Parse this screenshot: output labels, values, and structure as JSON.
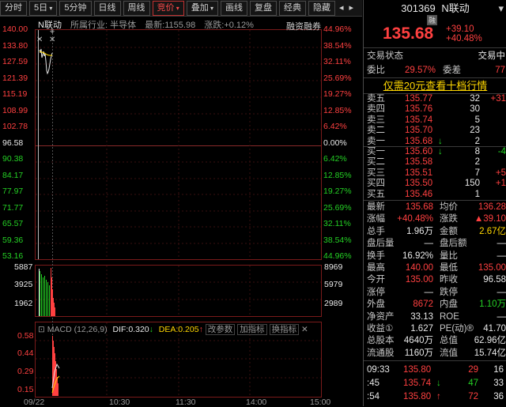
{
  "toolbar": {
    "tabs": [
      "分时",
      "5日",
      "5分钟",
      "日线",
      "周线",
      "竞价",
      "叠加",
      "画线",
      "复盘",
      "经典",
      "隐藏"
    ],
    "nav_left": "◂",
    "nav_right": "▸"
  },
  "chart": {
    "stock_name": "N联动",
    "industry": "所属行业: 半导体",
    "latest": "最新:1155.98",
    "change": "涨跌:+0.12%",
    "rzrq": "融资融券",
    "price_labels": [
      "140.00",
      "133.80",
      "127.59",
      "121.39",
      "115.19",
      "108.99",
      "102.78",
      "96.58",
      "90.38",
      "84.17",
      "77.97",
      "71.77",
      "65.57",
      "59.36",
      "53.16"
    ],
    "pct_labels": [
      "44.96%",
      "38.54%",
      "32.11%",
      "25.69%",
      "19.27%",
      "12.85%",
      "6.42%",
      "0.00%",
      "6.42%",
      "12.85%",
      "19.27%",
      "25.69%",
      "32.11%",
      "38.54%",
      "44.96%"
    ],
    "vol_left": [
      "5887",
      "3925",
      "1962"
    ],
    "vol_right": [
      "8969",
      "5979",
      "2989"
    ],
    "macd_title": "MACD (12,26,9)",
    "dif": "DIF:0.320",
    "dea": "DEA:0.205",
    "macd_btn1": "改参数",
    "macd_btn2": "加指标",
    "macd_btn3": "换指标",
    "macd_left": [
      "0.58",
      "0.44",
      "0.29",
      "0.15"
    ],
    "time_labels": [
      "09/22",
      "10:30",
      "11:30",
      "14:00",
      "15:00"
    ]
  },
  "panel": {
    "code": "301369",
    "name": "N联动",
    "badge": "融",
    "price": "135.68",
    "chg": "+39.10",
    "chg_pct": "+40.48%",
    "status_label": "交易状态",
    "status_val": "交易中",
    "weibi_label": "委比",
    "weibi_val": "29.57%",
    "weicha_label": "委差",
    "weicha_val": "77",
    "promo": "仅需20元查看十档行情",
    "sells": [
      {
        "label": "卖五",
        "price": "135.77",
        "vol": "32",
        "chg": "+31"
      },
      {
        "label": "卖四",
        "price": "135.76",
        "vol": "30",
        "chg": ""
      },
      {
        "label": "卖三",
        "price": "135.74",
        "vol": "5",
        "chg": ""
      },
      {
        "label": "卖二",
        "price": "135.70",
        "vol": "23",
        "chg": ""
      },
      {
        "label": "卖一",
        "price": "135.68",
        "vol": "2",
        "chg": ""
      }
    ],
    "buys": [
      {
        "label": "买一",
        "price": "135.60",
        "vol": "8",
        "chg": "-4"
      },
      {
        "label": "买二",
        "price": "135.58",
        "vol": "2",
        "chg": ""
      },
      {
        "label": "买三",
        "price": "135.51",
        "vol": "7",
        "chg": "+5"
      },
      {
        "label": "买四",
        "price": "135.50",
        "vol": "150",
        "chg": "+1"
      },
      {
        "label": "买五",
        "price": "135.46",
        "vol": "1",
        "chg": ""
      }
    ],
    "stats": [
      {
        "l1": "最新",
        "v1": "135.68",
        "c1": "red",
        "l2": "均价",
        "v2": "136.28",
        "c2": "red"
      },
      {
        "l1": "涨幅",
        "v1": "+40.48%",
        "c1": "red",
        "l2": "涨跌",
        "v2": "▲39.10",
        "c2": "red"
      },
      {
        "l1": "总手",
        "v1": "1.96万",
        "c1": "white",
        "l2": "金额",
        "v2": "2.67亿",
        "c2": "yellow"
      },
      {
        "l1": "盘后量",
        "v1": "—",
        "c1": "white",
        "l2": "盘后额",
        "v2": "—",
        "c2": "white"
      },
      {
        "l1": "换手",
        "v1": "16.92%",
        "c1": "white",
        "l2": "量比",
        "v2": "—",
        "c2": "white"
      },
      {
        "l1": "最高",
        "v1": "140.00",
        "c1": "red",
        "l2": "最低",
        "v2": "135.00",
        "c2": "red"
      },
      {
        "l1": "今开",
        "v1": "135.00",
        "c1": "red",
        "l2": "昨收",
        "v2": "96.58",
        "c2": "white"
      },
      {
        "l1": "涨停",
        "v1": "—",
        "c1": "white",
        "l2": "跌停",
        "v2": "—",
        "c2": "white"
      },
      {
        "l1": "外盘",
        "v1": "8672",
        "c1": "red",
        "l2": "内盘",
        "v2": "1.10万",
        "c2": "green"
      },
      {
        "l1": "净资产",
        "v1": "33.13",
        "c1": "white",
        "l2": "ROE",
        "v2": "—",
        "c2": "white"
      },
      {
        "l1": "收益①",
        "v1": "1.627",
        "c1": "white",
        "l2": "PE(动)®",
        "v2": "41.70",
        "c2": "white"
      },
      {
        "l1": "总股本",
        "v1": "4640万",
        "c1": "white",
        "l2": "总值",
        "v2": "62.96亿",
        "c2": "white"
      },
      {
        "l1": "流通股",
        "v1": "1160万",
        "c1": "white",
        "l2": "流值",
        "v2": "15.74亿",
        "c2": "white"
      }
    ],
    "ticks": [
      {
        "time": "09:33",
        "price": "135.80",
        "arrow": "",
        "vol": "29",
        "n": "16"
      },
      {
        "time": ":45",
        "price": "135.74",
        "arrow": "↓",
        "vol": "47",
        "n": "33"
      },
      {
        "time": ":54",
        "price": "135.80",
        "arrow": "↑",
        "vol": "72",
        "n": "36"
      }
    ]
  }
}
